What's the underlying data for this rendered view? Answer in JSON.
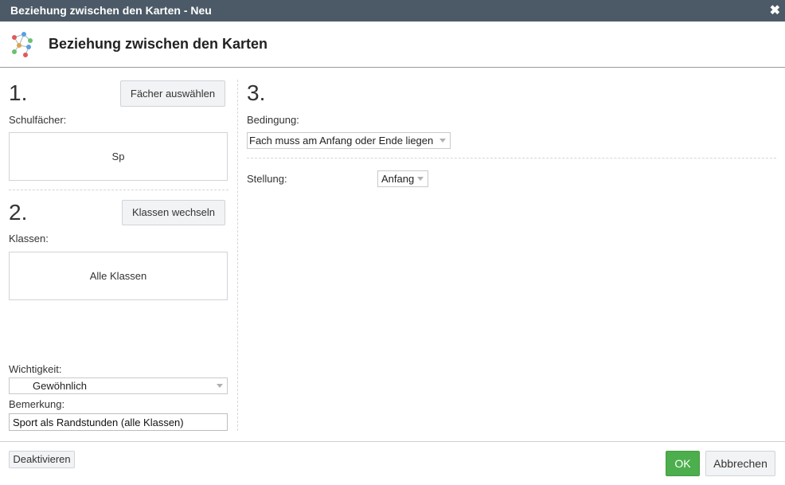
{
  "window": {
    "title": "Beziehung zwischen den Karten - Neu",
    "close_icon": "close-icon"
  },
  "header": {
    "title": "Beziehung zwischen den Karten",
    "icon": "network-graph-icon"
  },
  "section1": {
    "number": "1.",
    "button_label": "Fächer auswählen",
    "field_label": "Schulfächer:",
    "value": "Sp"
  },
  "section2": {
    "number": "2.",
    "button_label": "Klassen wechseln",
    "field_label": "Klassen:",
    "value": "Alle Klassen"
  },
  "importance": {
    "label": "Wichtigkeit:",
    "value": "Gewöhnlich"
  },
  "remark": {
    "label": "Bemerkung:",
    "value": "Sport als Randstunden (alle Klassen)"
  },
  "section3": {
    "number": "3.",
    "condition_label": "Bedingung:",
    "condition_value": "Fach muss am Anfang oder Ende liegen",
    "position_label": "Stellung:",
    "position_value": "Anfang"
  },
  "footer": {
    "deactivate_label": "Deaktivieren",
    "ok_label": "OK",
    "cancel_label": "Abbrechen"
  }
}
